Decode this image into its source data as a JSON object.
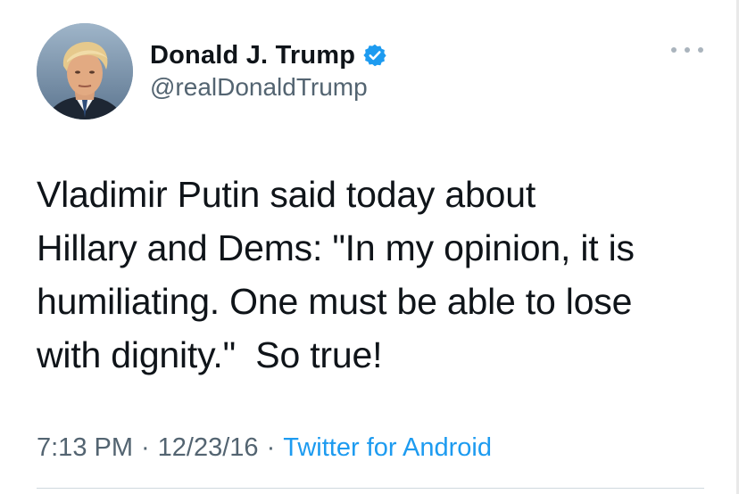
{
  "author": {
    "display_name": "Donald J. Trump",
    "handle": "@realDonaldTrump",
    "verified": true,
    "avatar_icon": "profile-photo"
  },
  "tweet": {
    "text": "Vladimir Putin said today about\nHillary and Dems: \"In my opinion, it is\nhumiliating. One must be able to lose\nwith dignity.\"  So true!"
  },
  "meta": {
    "time": "7:13 PM",
    "separator": "·",
    "date": "12/23/16",
    "source": "Twitter for Android"
  },
  "colors": {
    "accent": "#1d9bf0",
    "text": "#0f1419",
    "secondary": "#536471"
  },
  "icons": {
    "verified": "verified-badge-icon",
    "more": "more-options-icon"
  }
}
